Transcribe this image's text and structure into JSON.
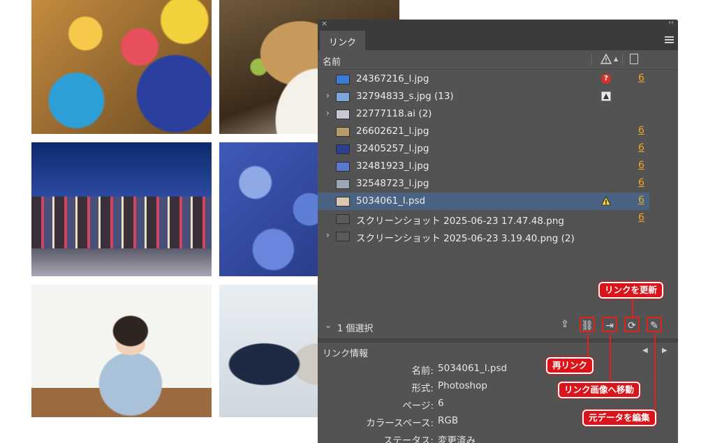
{
  "panel": {
    "close_glyph": "×",
    "collapse_glyph": "‹‹",
    "tab_label": "リンク",
    "menu_icon": "hamburger-menu-icon",
    "columns": {
      "name": "名前",
      "status_icon": "warning-triangle-icon",
      "sort_glyph": "▲",
      "page_icon": "page-icon"
    },
    "rows": [
      {
        "name": "24367216_l.jpg",
        "expand": "",
        "status": "missing",
        "status_glyph": "?",
        "page": "6",
        "thumb_color": "#3b7bd3",
        "selected": false
      },
      {
        "name": "32794833_s.jpg (13)",
        "expand": "›",
        "status": "embedded",
        "status_glyph": "",
        "page": "",
        "thumb_color": "#7aa7d8",
        "selected": false
      },
      {
        "name": "22777118.ai (2)",
        "expand": "›",
        "status": "",
        "status_glyph": "",
        "page": "",
        "thumb_color": "#c7c7d8",
        "selected": false
      },
      {
        "name": "26602621_l.jpg",
        "expand": "",
        "status": "",
        "status_glyph": "",
        "page": "6",
        "thumb_color": "#b99a6b",
        "selected": false
      },
      {
        "name": "32405257_l.jpg",
        "expand": "",
        "status": "",
        "status_glyph": "",
        "page": "6",
        "thumb_color": "#2b3f8e",
        "selected": false
      },
      {
        "name": "32481923_l.jpg",
        "expand": "",
        "status": "",
        "status_glyph": "",
        "page": "6",
        "thumb_color": "#5b78d0",
        "selected": false
      },
      {
        "name": "32548723_l.jpg",
        "expand": "",
        "status": "",
        "status_glyph": "",
        "page": "6",
        "thumb_color": "#9aa7b6",
        "selected": false
      },
      {
        "name": "5034061_l.psd",
        "expand": "",
        "status": "modified",
        "status_glyph": "!",
        "page": "6",
        "thumb_color": "#d9c7b1",
        "selected": true
      },
      {
        "name": "スクリーンショット 2025-06-23 17.47.48.png",
        "expand": "",
        "status": "",
        "status_glyph": "",
        "page": "6",
        "thumb_color": "#5a5a5a",
        "selected": false
      },
      {
        "name": "スクリーンショット 2025-06-23 3.19.40.png (2)",
        "expand": "›",
        "status": "",
        "status_glyph": "",
        "page": "",
        "thumb_color": "#5a5a5a",
        "selected": false
      }
    ],
    "selection": {
      "expand_glyph": "⌄",
      "label": "1 個選択"
    },
    "toolbar": {
      "cc_glyph": "⇪",
      "relink_glyph": "⛓",
      "goto_glyph": "⇥",
      "update_glyph": "⟳",
      "edit_glyph": "✎"
    },
    "info": {
      "label": "リンク情報",
      "prev_glyph": "◀",
      "next_glyph": "▶",
      "fields": [
        {
          "key": "名前:",
          "value": "5034061_l.psd"
        },
        {
          "key": "形式:",
          "value": "Photoshop"
        },
        {
          "key": "ページ:",
          "value": "6"
        },
        {
          "key": "カラースペース:",
          "value": "RGB"
        },
        {
          "key": "ステータス:",
          "value": "変更済み"
        }
      ]
    }
  },
  "callouts": {
    "update": "リンクを更新",
    "relink": "再リンク",
    "goto": "リンク画像へ移動",
    "edit": "元データを編集"
  },
  "colors": {
    "panel_bg": "#535353",
    "selected_row": "#4a6382",
    "page_link": "#f1a62b",
    "callout_red": "#d9141a"
  }
}
